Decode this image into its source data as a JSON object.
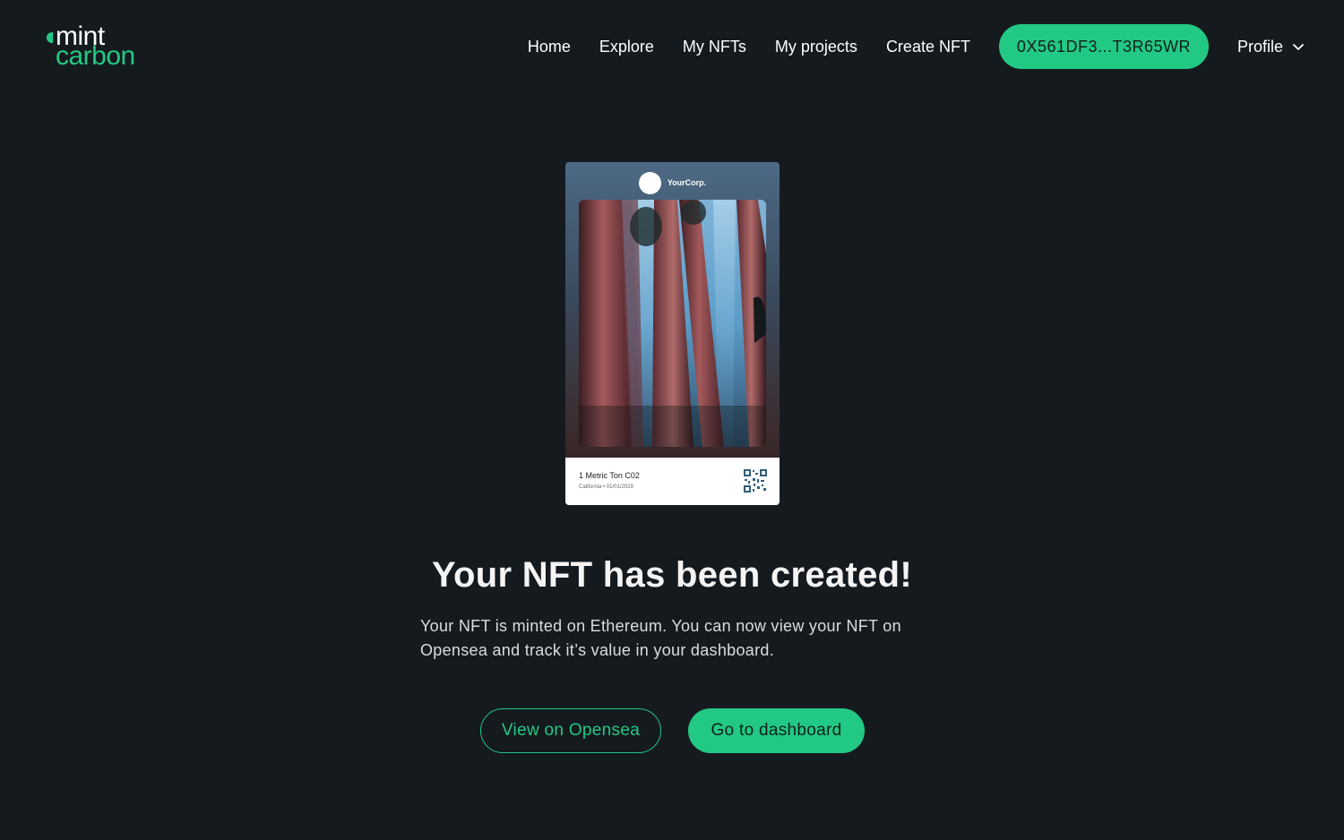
{
  "brand": {
    "line1": "mint",
    "line2": "carbon",
    "accent_color": "#22c984"
  },
  "nav": {
    "links": [
      "Home",
      "Explore",
      "My NFTs",
      "My projects",
      "Create NFT"
    ],
    "wallet_label": "0X561DF3...T3R65WR",
    "profile_label": "Profile",
    "profile_icon": "chevron-down-icon"
  },
  "nft_card": {
    "corp_name": "YourCorp.",
    "title": "1 Metric Ton C02",
    "subtitle": "California • 01/01/2029",
    "image": "redwood-forest-image",
    "qr_icon": "qr-code-icon"
  },
  "main": {
    "headline": "Your NFT has been created!",
    "description": "Your NFT is minted on Ethereum. You can now view your NFT on Opensea and track it’s value in your dashboard.",
    "secondary_button": "View on Opensea",
    "primary_button": "Go to dashboard"
  },
  "colors": {
    "background": "#151a1f",
    "accent": "#22c984"
  }
}
